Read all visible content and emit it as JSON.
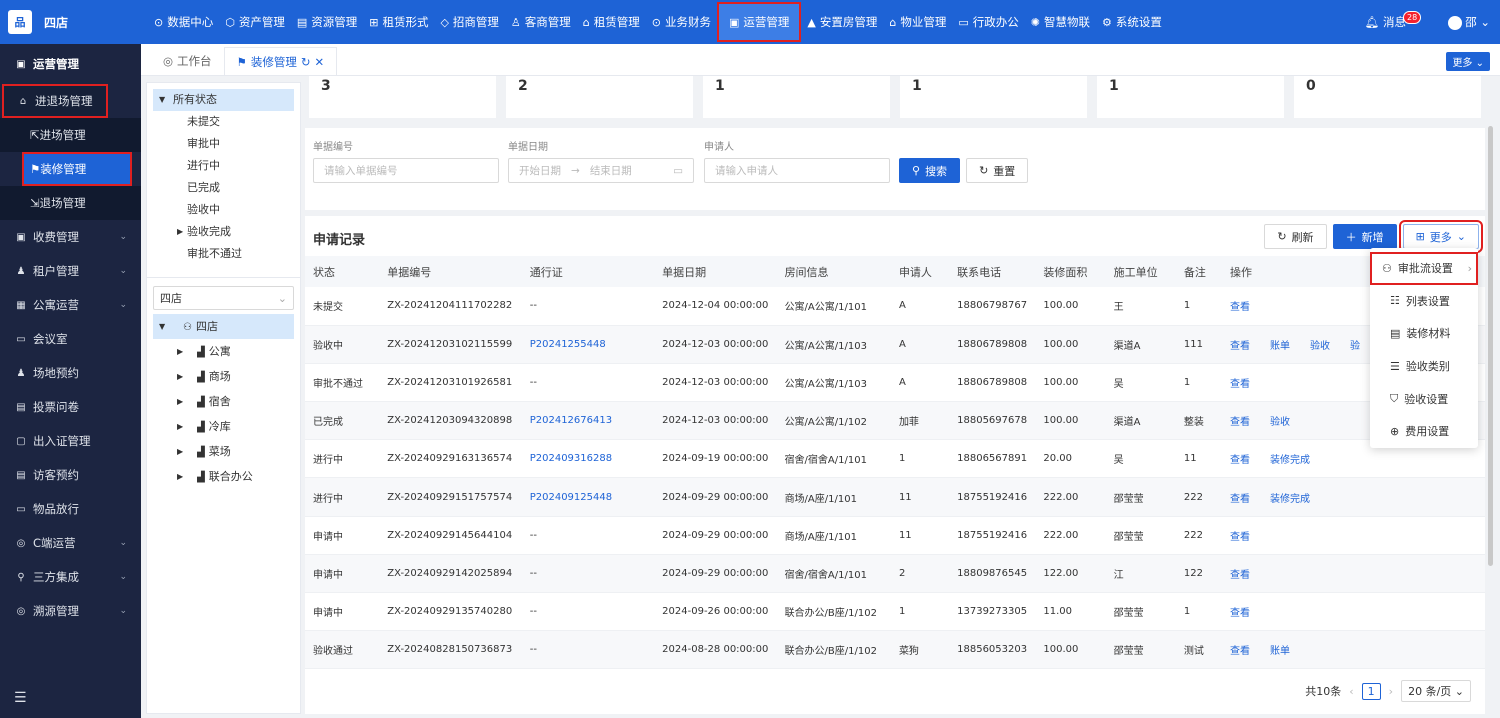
{
  "header": {
    "logo_text": "四店",
    "nav": [
      {
        "label": "数据中心",
        "icon": "⊙"
      },
      {
        "label": "资产管理",
        "icon": "⬡"
      },
      {
        "label": "资源管理",
        "icon": "▤"
      },
      {
        "label": "租赁形式",
        "icon": "⊞"
      },
      {
        "label": "招商管理",
        "icon": "◇"
      },
      {
        "label": "客商管理",
        "icon": "♙"
      },
      {
        "label": "租赁管理",
        "icon": "⌂"
      },
      {
        "label": "业务财务",
        "icon": "⊙"
      },
      {
        "label": "运营管理",
        "icon": "▣"
      },
      {
        "label": "安置房管理",
        "icon": "▲"
      },
      {
        "label": "物业管理",
        "icon": "⌂"
      },
      {
        "label": "行政办公",
        "icon": "▭"
      },
      {
        "label": "智慧物联",
        "icon": "✺"
      },
      {
        "label": "系统设置",
        "icon": "⚙"
      }
    ],
    "messages_label": "消息",
    "message_count": "28",
    "user_label": "邵"
  },
  "sidebar": {
    "title": "运营管理",
    "items": [
      {
        "label": "进退场管理",
        "icon": "⌂",
        "open": true
      },
      {
        "label": "收费管理",
        "icon": "▣"
      },
      {
        "label": "租户管理",
        "icon": "♟"
      },
      {
        "label": "公寓运营",
        "icon": "▦"
      },
      {
        "label": "会议室",
        "icon": "▭"
      },
      {
        "label": "场地预约",
        "icon": "♟"
      },
      {
        "label": "投票问卷",
        "icon": "▤"
      },
      {
        "label": "出入证管理",
        "icon": "▢"
      },
      {
        "label": "访客预约",
        "icon": "▤"
      },
      {
        "label": "物品放行",
        "icon": "▭"
      },
      {
        "label": "C端运营",
        "icon": "◎"
      },
      {
        "label": "三方集成",
        "icon": "⚲"
      },
      {
        "label": "溯源管理",
        "icon": "◎"
      }
    ],
    "sub_items": [
      {
        "label": "进场管理",
        "icon": "⇱"
      },
      {
        "label": "装修管理",
        "icon": "⚑"
      },
      {
        "label": "退场管理",
        "icon": "⇲"
      }
    ]
  },
  "tabs": [
    {
      "label": "工作台",
      "icon": "◎"
    },
    {
      "label": "装修管理",
      "icon": "⚑"
    }
  ],
  "tabs_more": "更多",
  "status_tree": {
    "root": "所有状态",
    "items": [
      "未提交",
      "审批中",
      "进行中",
      "已完成",
      "验收中",
      "验收完成",
      "审批不通过"
    ]
  },
  "store_select": "四店",
  "store_tree": {
    "root": "四店",
    "items": [
      "公寓",
      "商场",
      "宿舍",
      "冷库",
      "菜场",
      "联合办公"
    ]
  },
  "stats": [
    "3",
    "2",
    "1",
    "1",
    "1",
    "0"
  ],
  "search": {
    "doc_no_label": "单据编号",
    "doc_no_placeholder": "请输入单据编号",
    "date_label": "单据日期",
    "date_start": "开始日期",
    "date_arrow": "→",
    "date_end": "结束日期",
    "applicant_label": "申请人",
    "applicant_placeholder": "请输入申请人",
    "search_btn": "搜索",
    "reset_btn": "重置"
  },
  "records": {
    "title": "申请记录",
    "refresh_btn": "刷新",
    "add_btn": "新增",
    "more_btn": "更多",
    "columns": [
      "状态",
      "单据编号",
      "通行证",
      "单据日期",
      "房间信息",
      "申请人",
      "联系电话",
      "装修面积",
      "施工单位",
      "备注",
      "操作"
    ],
    "rows": [
      {
        "status": "未提交",
        "no": "ZX-20241204111702282",
        "pass": "--",
        "date": "2024-12-04 00:00:00",
        "room": "公寓/A公寓/1/101",
        "applicant": "A",
        "phone": "18806798767",
        "area": "100.00",
        "unit": "王",
        "note": "1",
        "ops": [
          "查看"
        ]
      },
      {
        "status": "验收中",
        "no": "ZX-20241203102115599",
        "pass": "P20241255448",
        "date": "2024-12-03 00:00:00",
        "room": "公寓/A公寓/1/103",
        "applicant": "A",
        "phone": "18806789808",
        "area": "100.00",
        "unit": "渠道A",
        "note": "111",
        "ops": [
          "查看",
          "账单",
          "验收",
          "验"
        ]
      },
      {
        "status": "审批不通过",
        "no": "ZX-20241203101926581",
        "pass": "--",
        "date": "2024-12-03 00:00:00",
        "room": "公寓/A公寓/1/103",
        "applicant": "A",
        "phone": "18806789808",
        "area": "100.00",
        "unit": "吴",
        "note": "1",
        "ops": [
          "查看"
        ]
      },
      {
        "status": "已完成",
        "no": "ZX-20241203094320898",
        "pass": "P202412676413",
        "date": "2024-12-03 00:00:00",
        "room": "公寓/A公寓/1/102",
        "applicant": "加菲",
        "phone": "18805697678",
        "area": "100.00",
        "unit": "渠道A",
        "note": "整装",
        "ops": [
          "查看",
          "验收"
        ]
      },
      {
        "status": "进行中",
        "no": "ZX-20240929163136574",
        "pass": "P202409316288",
        "date": "2024-09-19 00:00:00",
        "room": "宿舍/宿舍A/1/101",
        "applicant": "1",
        "phone": "18806567891",
        "area": "20.00",
        "unit": "吴",
        "note": "11",
        "ops": [
          "查看",
          "装修完成"
        ]
      },
      {
        "status": "进行中",
        "no": "ZX-20240929151757574",
        "pass": "P202409125448",
        "date": "2024-09-29 00:00:00",
        "room": "商场/A座/1/101",
        "applicant": "11",
        "phone": "18755192416",
        "area": "222.00",
        "unit": "邵莹莹",
        "note": "222",
        "ops": [
          "查看",
          "装修完成"
        ]
      },
      {
        "status": "申请中",
        "no": "ZX-20240929145644104",
        "pass": "--",
        "date": "2024-09-29 00:00:00",
        "room": "商场/A座/1/101",
        "applicant": "11",
        "phone": "18755192416",
        "area": "222.00",
        "unit": "邵莹莹",
        "note": "222",
        "ops": [
          "查看"
        ]
      },
      {
        "status": "申请中",
        "no": "ZX-20240929142025894",
        "pass": "--",
        "date": "2024-09-29 00:00:00",
        "room": "宿舍/宿舍A/1/101",
        "applicant": "2",
        "phone": "18809876545",
        "area": "122.00",
        "unit": "江",
        "note": "122",
        "ops": [
          "查看"
        ]
      },
      {
        "status": "申请中",
        "no": "ZX-20240929135740280",
        "pass": "--",
        "date": "2024-09-26 00:00:00",
        "room": "联合办公/B座/1/102",
        "applicant": "1",
        "phone": "13739273305",
        "area": "11.00",
        "unit": "邵莹莹",
        "note": "1",
        "ops": [
          "查看"
        ]
      },
      {
        "status": "验收通过",
        "no": "ZX-20240828150736873",
        "pass": "--",
        "date": "2024-08-28 00:00:00",
        "room": "联合办公/B座/1/102",
        "applicant": "菜狗",
        "phone": "18856053203",
        "area": "100.00",
        "unit": "邵莹莹",
        "note": "测试",
        "ops": [
          "查看",
          "账单"
        ]
      }
    ]
  },
  "pager": {
    "total": "共10条",
    "page": "1",
    "size": "20 条/页"
  },
  "dropdown": [
    {
      "label": "审批流设置",
      "icon": "⚇"
    },
    {
      "label": "列表设置",
      "icon": "☷"
    },
    {
      "label": "装修材料",
      "icon": "▤"
    },
    {
      "label": "验收类别",
      "icon": "☰"
    },
    {
      "label": "验收设置",
      "icon": "⛉"
    },
    {
      "label": "费用设置",
      "icon": "⊕"
    }
  ]
}
